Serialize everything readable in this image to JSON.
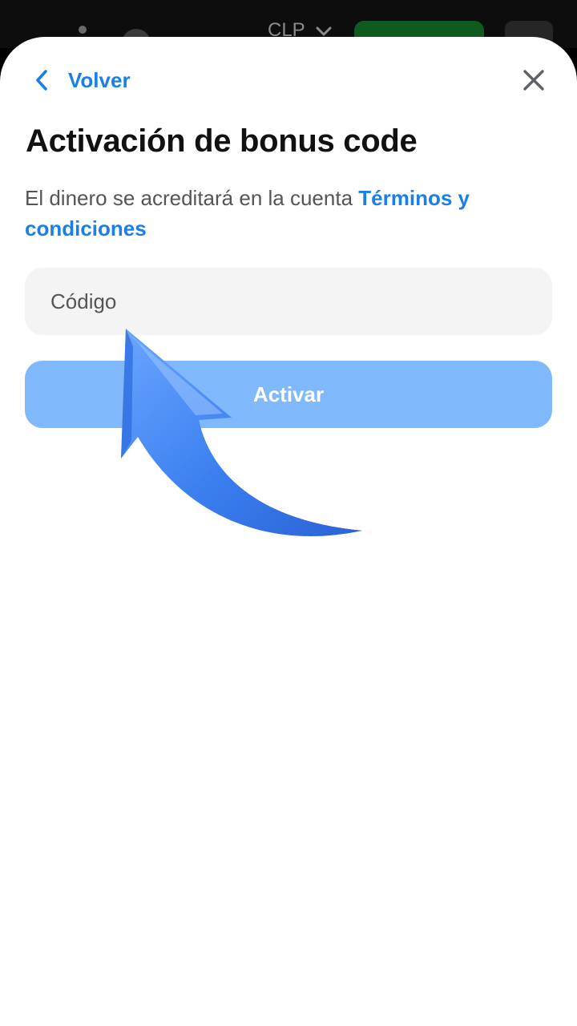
{
  "backdrop": {
    "currency": "CLP"
  },
  "header": {
    "back_label": "Volver"
  },
  "title": "Activación de bonus code",
  "subtitle": {
    "text": "El dinero se acreditará en la cuenta",
    "terms_link": "Términos y condiciones"
  },
  "code_field": {
    "placeholder": "Código",
    "value": ""
  },
  "activate_button": {
    "label": "Activar"
  },
  "colors": {
    "accent": "#1a7fe6",
    "button_disabled": "#80b9fb",
    "input_background": "#f4f4f4",
    "arrow": "#3b7ff0"
  },
  "icons": {
    "back": "chevron-left-icon",
    "close": "close-icon",
    "currency_dropdown": "chevron-down-icon",
    "annotation": "curved-arrow-pointer"
  }
}
